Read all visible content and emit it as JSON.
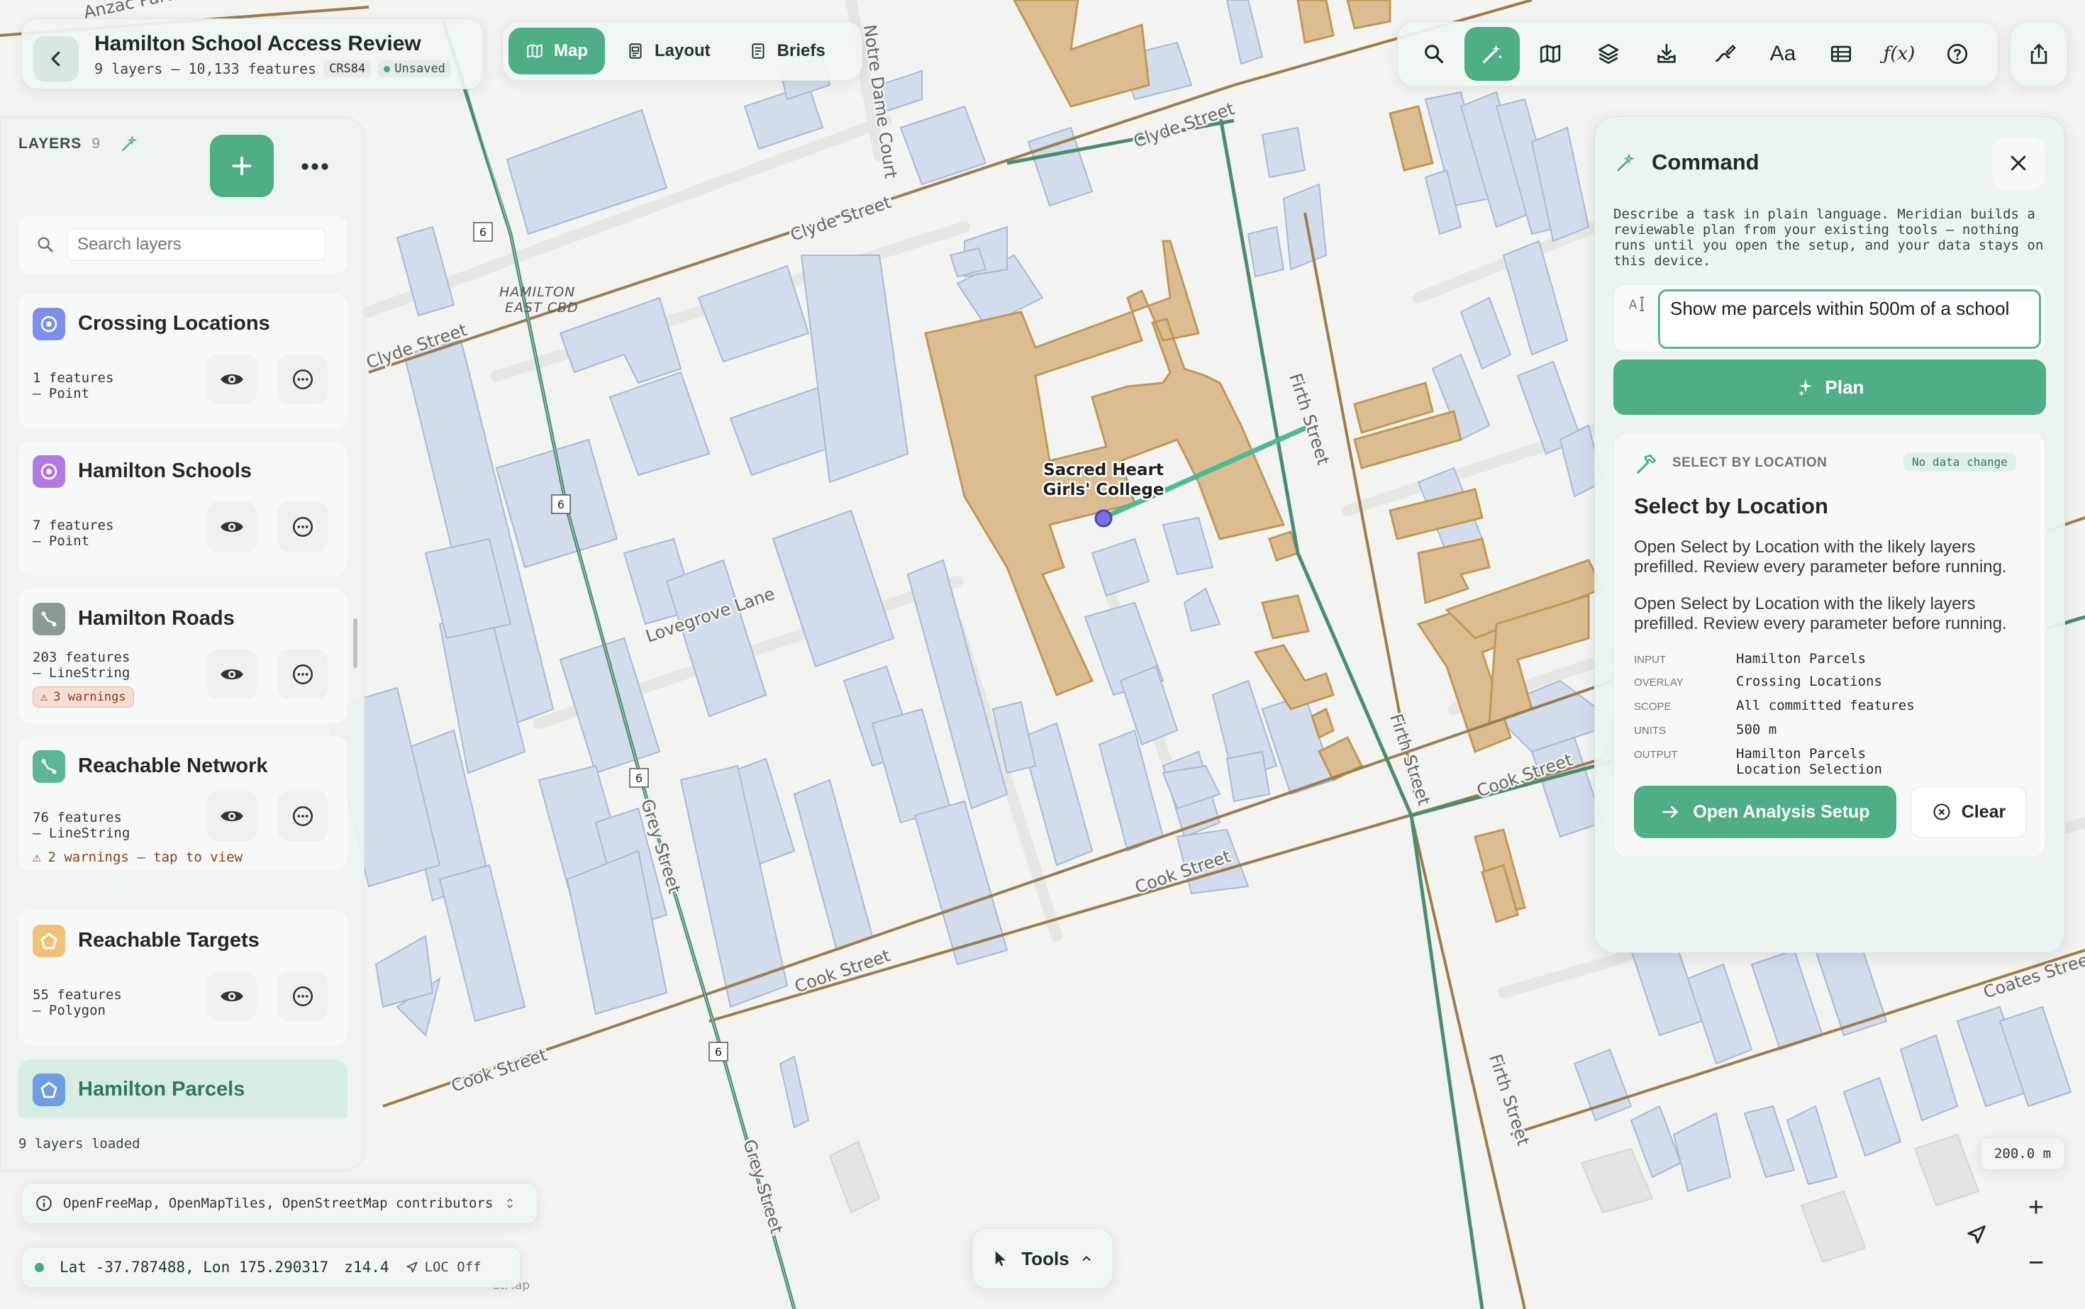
{
  "project": {
    "title": "Hamilton School Access Review",
    "meta": "9 layers – 10,133 features",
    "crs": "CRS84",
    "status": "Unsaved"
  },
  "modes": [
    {
      "label": "Map",
      "icon": "map-icon",
      "active": true
    },
    {
      "label": "Layout",
      "icon": "layout-icon",
      "active": false
    },
    {
      "label": "Briefs",
      "icon": "briefs-icon",
      "active": false
    }
  ],
  "toolbar": {
    "tools": [
      "search-icon",
      "command-sparkle-icon",
      "basemap-icon",
      "layers-stack-icon",
      "import-icon",
      "draw-icon",
      "text-style-icon",
      "table-icon",
      "function-icon",
      "help-icon"
    ],
    "text_tool_label": "Aa",
    "function_label": "ƒ(x)",
    "active_tool": "command-sparkle-icon"
  },
  "layers_panel": {
    "heading": "LAYERS",
    "count": "9",
    "search_placeholder": "Search layers",
    "status": "9 layers loaded",
    "layers": [
      {
        "name": "Crossing Locations",
        "count": "1 features",
        "geom": "– Point",
        "color": "#7d8fe8",
        "icon": "point-icon"
      },
      {
        "name": "Hamilton Schools",
        "count": "7 features",
        "geom": "– Point",
        "color": "#b27ae0",
        "icon": "point-icon"
      },
      {
        "name": "Hamilton Roads",
        "count": "203 features",
        "geom": "– LineString",
        "warning": "3 warnings",
        "color": "#8c9995",
        "icon": "line-icon"
      },
      {
        "name": "Reachable Network",
        "count": "76 features",
        "geom": "– LineString",
        "warning_line": "2 warnings — tap to view",
        "color": "#5bb596",
        "icon": "line-icon"
      },
      {
        "name": "Reachable Targets",
        "count": "55 features",
        "geom": "– Polygon",
        "color": "#efc27a",
        "icon": "polygon-icon"
      },
      {
        "name": "Hamilton Parcels",
        "selected": true,
        "color": "#6f9ee0",
        "icon": "polygon-icon"
      }
    ]
  },
  "map": {
    "attribution": "OpenFreeMap, OpenMapTiles, OpenStreetMap contributors",
    "coords": "Lat -37.787488, Lon 175.290317",
    "zoom": "z14.4",
    "loc": "LOC Off",
    "scale": "200.0 m",
    "tools_label": "Tools",
    "labels": {
      "school_line1": "Sacred Heart",
      "school_line2": "Girls' College",
      "clyde_a": "Clyde Street",
      "clyde_b": "Clyde Street",
      "clyde_c": "Clyde Street",
      "cook_a": "Cook Street",
      "cook_b": "Cook Street",
      "cook_c": "Cook Street",
      "cook_d": "Cook Street",
      "firth_a": "Firth Street",
      "firth_b": "Firth Street",
      "firth_c": "Firth Street",
      "grey_a": "Grey Street",
      "grey_b": "Grey Street",
      "lovegrove": "Lovegrove Lane",
      "notre_dame": "Notre Dame Court",
      "coates": "Coates Stree",
      "cbd1": "HAMILTON",
      "cbd2": "EAST CBD",
      "anzac": "Anzac Parade",
      "route": "6",
      "osm_tail": "etMap"
    }
  },
  "command": {
    "title": "Command",
    "description": "Describe a task in plain language. Meridian builds a reviewable plan from your existing tools — nothing runs until you open the setup, and your data stays on this device.",
    "input_value": "Show me parcels within 500m of a school",
    "plan_label": "Plan",
    "result": {
      "kicker": "SELECT BY LOCATION",
      "badge": "No data change",
      "title": "Select by Location",
      "para1": "Open Select by Location with the likely layers prefilled. Review every parameter before running.",
      "para2": "Open Select by Location with the likely layers prefilled. Review every parameter before running.",
      "params": [
        {
          "key": "INPUT",
          "value": "Hamilton Parcels"
        },
        {
          "key": "OVERLAY",
          "value": "Crossing Locations"
        },
        {
          "key": "SCOPE",
          "value": "All committed features"
        },
        {
          "key": "UNITS",
          "value": "500 m"
        },
        {
          "key": "OUTPUT",
          "value": "Hamilton Parcels Location Selection"
        }
      ],
      "open_label": "Open Analysis Setup",
      "clear_label": "Clear"
    }
  }
}
